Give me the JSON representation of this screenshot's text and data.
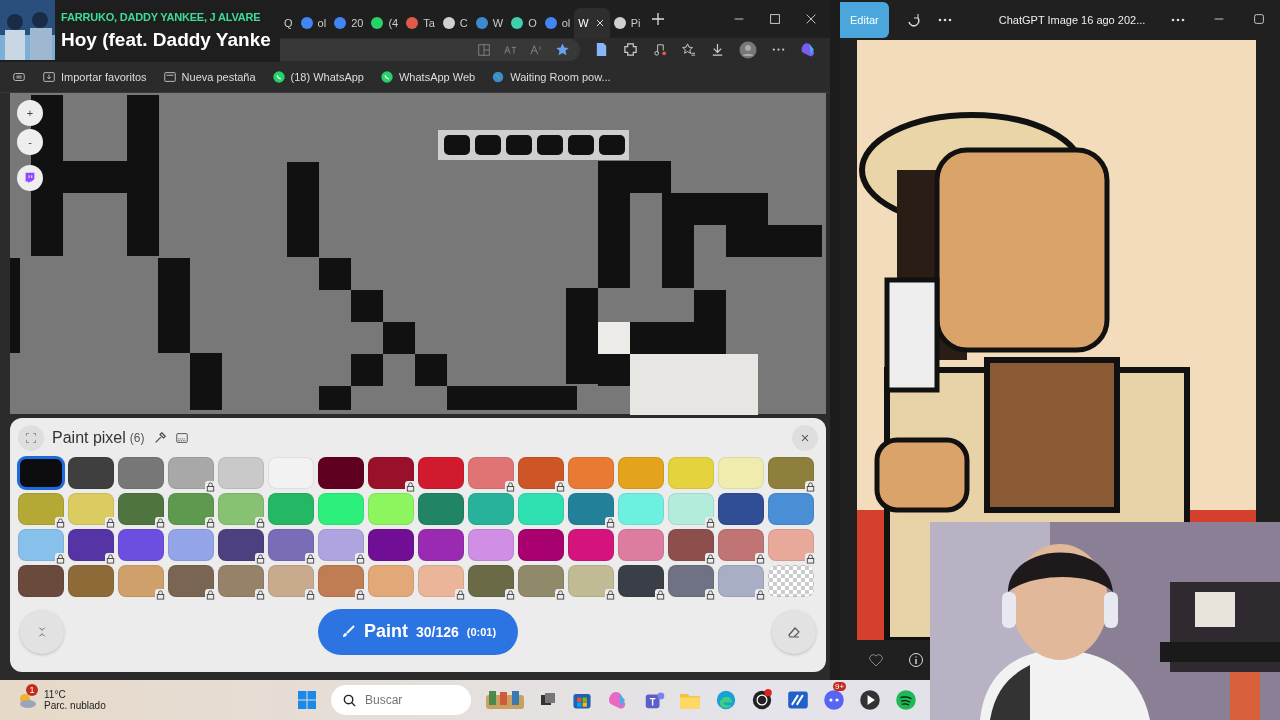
{
  "music_overlay": {
    "artist": "FARRUKO, DADDY YANKEE, J ALVARE",
    "title": "Hoy (feat. Daddy Yanke"
  },
  "tabs": [
    {
      "label": "Q",
      "selected": false
    },
    {
      "label": "ol",
      "color": "#4285f4",
      "selected": false
    },
    {
      "label": "20",
      "color": "#4285f4",
      "selected": false
    },
    {
      "label": "(4",
      "color": "#25d366",
      "selected": false
    },
    {
      "label": "Ta",
      "color": "#e05a4a",
      "selected": false
    },
    {
      "label": "C",
      "color": "#d0d0d0",
      "selected": false
    },
    {
      "label": "W",
      "color": "#3a8bd0",
      "selected": false
    },
    {
      "label": "O",
      "color": "#3fd0b0",
      "selected": false
    },
    {
      "label": "ol",
      "color": "#4285f4",
      "selected": false
    },
    {
      "label": "W",
      "selected": true
    },
    {
      "label": "Pi",
      "color": "#d0d0d0",
      "selected": false
    }
  ],
  "bookmarks": [
    {
      "label": "Importar favoritos",
      "kind": "import"
    },
    {
      "label": "Nueva pestaña",
      "kind": "page"
    },
    {
      "label": "(18) WhatsApp",
      "kind": "whatsapp"
    },
    {
      "label": "WhatsApp Web",
      "kind": "whatsapp"
    },
    {
      "label": "Waiting Room pow...",
      "kind": "globe"
    }
  ],
  "canvas": {
    "zoom_in": "+",
    "zoom_out": "-"
  },
  "paint_panel": {
    "title": "Paint pixel",
    "count": "(6)",
    "swatches": [
      {
        "kind": "color",
        "color": "#0d0d0f",
        "locked": false,
        "selected": true
      },
      {
        "kind": "color",
        "color": "#3f3f3f",
        "locked": false,
        "selected": false
      },
      {
        "kind": "color",
        "color": "#777777",
        "locked": false,
        "selected": false
      },
      {
        "kind": "color",
        "color": "#a8a8a8",
        "locked": true,
        "selected": false
      },
      {
        "kind": "color",
        "color": "#c9c9c9",
        "locked": false,
        "selected": false
      },
      {
        "kind": "color",
        "color": "#f2f2f2",
        "locked": false,
        "selected": false
      },
      {
        "kind": "color",
        "color": "#600020",
        "locked": false,
        "selected": false
      },
      {
        "kind": "color",
        "color": "#99102a",
        "locked": true,
        "selected": false
      },
      {
        "kind": "color",
        "color": "#d11a2e",
        "locked": false,
        "selected": false
      },
      {
        "kind": "color",
        "color": "#e07474",
        "locked": true,
        "selected": false
      },
      {
        "kind": "color",
        "color": "#cd5526",
        "locked": true,
        "selected": false
      },
      {
        "kind": "color",
        "color": "#e87a34",
        "locked": false,
        "selected": false
      },
      {
        "kind": "color",
        "color": "#e3a31a",
        "locked": false,
        "selected": false
      },
      {
        "kind": "color",
        "color": "#e5d33e",
        "locked": false,
        "selected": false
      },
      {
        "kind": "color",
        "color": "#f0ecb0",
        "locked": false,
        "selected": false
      },
      {
        "kind": "color",
        "color": "#8e803c",
        "locked": true,
        "selected": false
      },
      {
        "kind": "color",
        "color": "#b5a936",
        "locked": true,
        "selected": false
      },
      {
        "kind": "color",
        "color": "#dbcc62",
        "locked": true,
        "selected": false
      },
      {
        "kind": "color",
        "color": "#4f7440",
        "locked": true,
        "selected": false
      },
      {
        "kind": "color",
        "color": "#5e9a4e",
        "locked": true,
        "selected": false
      },
      {
        "kind": "color",
        "color": "#86c272",
        "locked": true,
        "selected": false
      },
      {
        "kind": "color",
        "color": "#25b864",
        "locked": false,
        "selected": false
      },
      {
        "kind": "color",
        "color": "#2cf07b",
        "locked": false,
        "selected": false
      },
      {
        "kind": "color",
        "color": "#8df55e",
        "locked": false,
        "selected": false
      },
      {
        "kind": "color",
        "color": "#218467",
        "locked": false,
        "selected": false
      },
      {
        "kind": "color",
        "color": "#27b39b",
        "locked": false,
        "selected": false
      },
      {
        "kind": "color",
        "color": "#2ee0b0",
        "locked": false,
        "selected": false
      },
      {
        "kind": "color",
        "color": "#238099",
        "locked": true,
        "selected": false
      },
      {
        "kind": "color",
        "color": "#6ef0e0",
        "locked": false,
        "selected": false
      },
      {
        "kind": "color",
        "color": "#b2ecdd",
        "locked": true,
        "selected": false
      },
      {
        "kind": "color",
        "color": "#2f4e96",
        "locked": false,
        "selected": false
      },
      {
        "kind": "color",
        "color": "#4a8ed6",
        "locked": false,
        "selected": false
      },
      {
        "kind": "color",
        "color": "#88c0ec",
        "locked": true,
        "selected": false
      },
      {
        "kind": "color",
        "color": "#5535a6",
        "locked": true,
        "selected": false
      },
      {
        "kind": "color",
        "color": "#6c4ee0",
        "locked": false,
        "selected": false
      },
      {
        "kind": "color",
        "color": "#93a4e8",
        "locked": false,
        "selected": false
      },
      {
        "kind": "color",
        "color": "#4d3f80",
        "locked": true,
        "selected": false
      },
      {
        "kind": "color",
        "color": "#7b6cb8",
        "locked": true,
        "selected": false
      },
      {
        "kind": "color",
        "color": "#b0a4e0",
        "locked": true,
        "selected": false
      },
      {
        "kind": "color",
        "color": "#700e96",
        "locked": false,
        "selected": false
      },
      {
        "kind": "color",
        "color": "#9a2ab2",
        "locked": false,
        "selected": false
      },
      {
        "kind": "color",
        "color": "#d08ee4",
        "locked": false,
        "selected": false
      },
      {
        "kind": "color",
        "color": "#a8006e",
        "locked": false,
        "selected": false
      },
      {
        "kind": "color",
        "color": "#d4137c",
        "locked": false,
        "selected": false
      },
      {
        "kind": "color",
        "color": "#dd7ca0",
        "locked": false,
        "selected": false
      },
      {
        "kind": "color",
        "color": "#8c4f4c",
        "locked": true,
        "selected": false
      },
      {
        "kind": "color",
        "color": "#c07474",
        "locked": true,
        "selected": false
      },
      {
        "kind": "color",
        "color": "#e8a89a",
        "locked": true,
        "selected": false
      },
      {
        "kind": "color",
        "color": "#6a4a3c",
        "locked": false,
        "selected": false
      },
      {
        "kind": "color",
        "color": "#8e6a38",
        "locked": false,
        "selected": false
      },
      {
        "kind": "color",
        "color": "#d0a06a",
        "locked": true,
        "selected": false
      },
      {
        "kind": "color",
        "color": "#7a6452",
        "locked": true,
        "selected": false
      },
      {
        "kind": "color",
        "color": "#968268",
        "locked": true,
        "selected": false
      },
      {
        "kind": "color",
        "color": "#c8aa8c",
        "locked": true,
        "selected": false
      },
      {
        "kind": "color",
        "color": "#c07c52",
        "locked": true,
        "selected": false
      },
      {
        "kind": "color",
        "color": "#e3a878",
        "locked": false,
        "selected": false
      },
      {
        "kind": "color",
        "color": "#ebb59a",
        "locked": true,
        "selected": false
      },
      {
        "kind": "color",
        "color": "#6a6a46",
        "locked": true,
        "selected": false
      },
      {
        "kind": "color",
        "color": "#908a6a",
        "locked": true,
        "selected": false
      },
      {
        "kind": "color",
        "color": "#c0bb94",
        "locked": true,
        "selected": false
      },
      {
        "kind": "color",
        "color": "#3a3e46",
        "locked": true,
        "selected": false
      },
      {
        "kind": "color",
        "color": "#6e7284",
        "locked": true,
        "selected": false
      },
      {
        "kind": "color",
        "color": "#a8aec4",
        "locked": true,
        "selected": false
      },
      {
        "kind": "transparent",
        "locked": false,
        "selected": false
      }
    ],
    "paint_button": {
      "label": "Paint",
      "progress": "30/126",
      "timer": "(0:01)"
    }
  },
  "viewer": {
    "edit_button": "Editar",
    "title": "ChatGPT Image 16 ago 202..."
  },
  "taskbar": {
    "weather_badge": "1",
    "temperature": "11°C",
    "condition": "Parc. nublado",
    "search_placeholder": "Buscar",
    "discord_badge": "9+"
  }
}
